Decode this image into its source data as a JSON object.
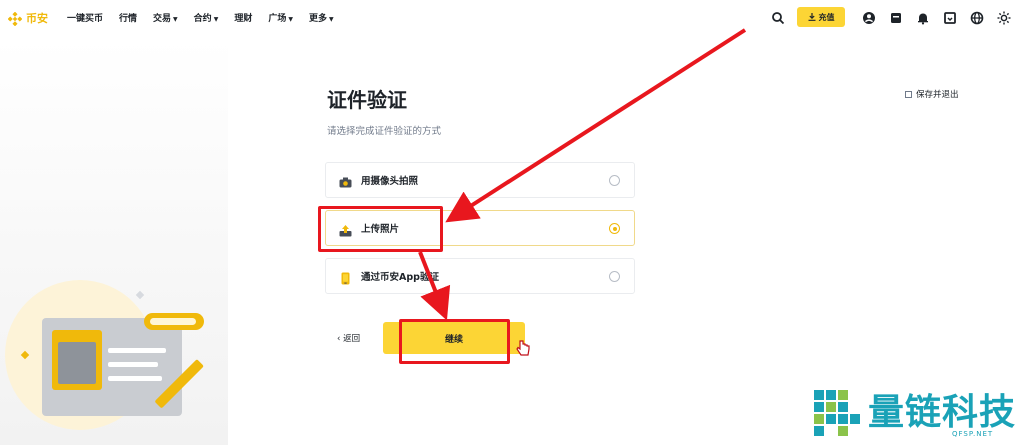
{
  "header": {
    "logo_text": "币安",
    "nav": [
      {
        "label": "一键买币",
        "has_menu": false
      },
      {
        "label": "行情",
        "has_menu": false
      },
      {
        "label": "交易",
        "has_menu": true
      },
      {
        "label": "合约",
        "has_menu": true
      },
      {
        "label": "理财",
        "has_menu": false
      },
      {
        "label": "广场",
        "has_menu": true
      },
      {
        "label": "更多",
        "has_menu": true
      }
    ],
    "deposit_label": "充值",
    "icons": [
      "search-icon",
      "user-icon",
      "orders-icon",
      "bell-icon",
      "download-icon",
      "globe-icon",
      "theme-icon"
    ]
  },
  "page": {
    "title": "证件验证",
    "subtitle": "请选择完成证件验证的方式",
    "save_exit": "保存并退出",
    "options": [
      {
        "label": "用摄像头拍照",
        "icon": "camera-icon",
        "selected": false
      },
      {
        "label": "上传照片",
        "icon": "upload-icon",
        "selected": true
      },
      {
        "label": "通过币安App验证",
        "icon": "phone-icon",
        "selected": false
      }
    ],
    "back_label": "返回",
    "continue_label": "继续"
  },
  "watermark": {
    "text": "量链科技",
    "sub": "QFSP.NET"
  },
  "colors": {
    "brand_yellow": "#f0b90b",
    "button_yellow": "#fcd535",
    "annotation_red": "#e8171e",
    "watermark_teal": "#1aa2b7"
  }
}
